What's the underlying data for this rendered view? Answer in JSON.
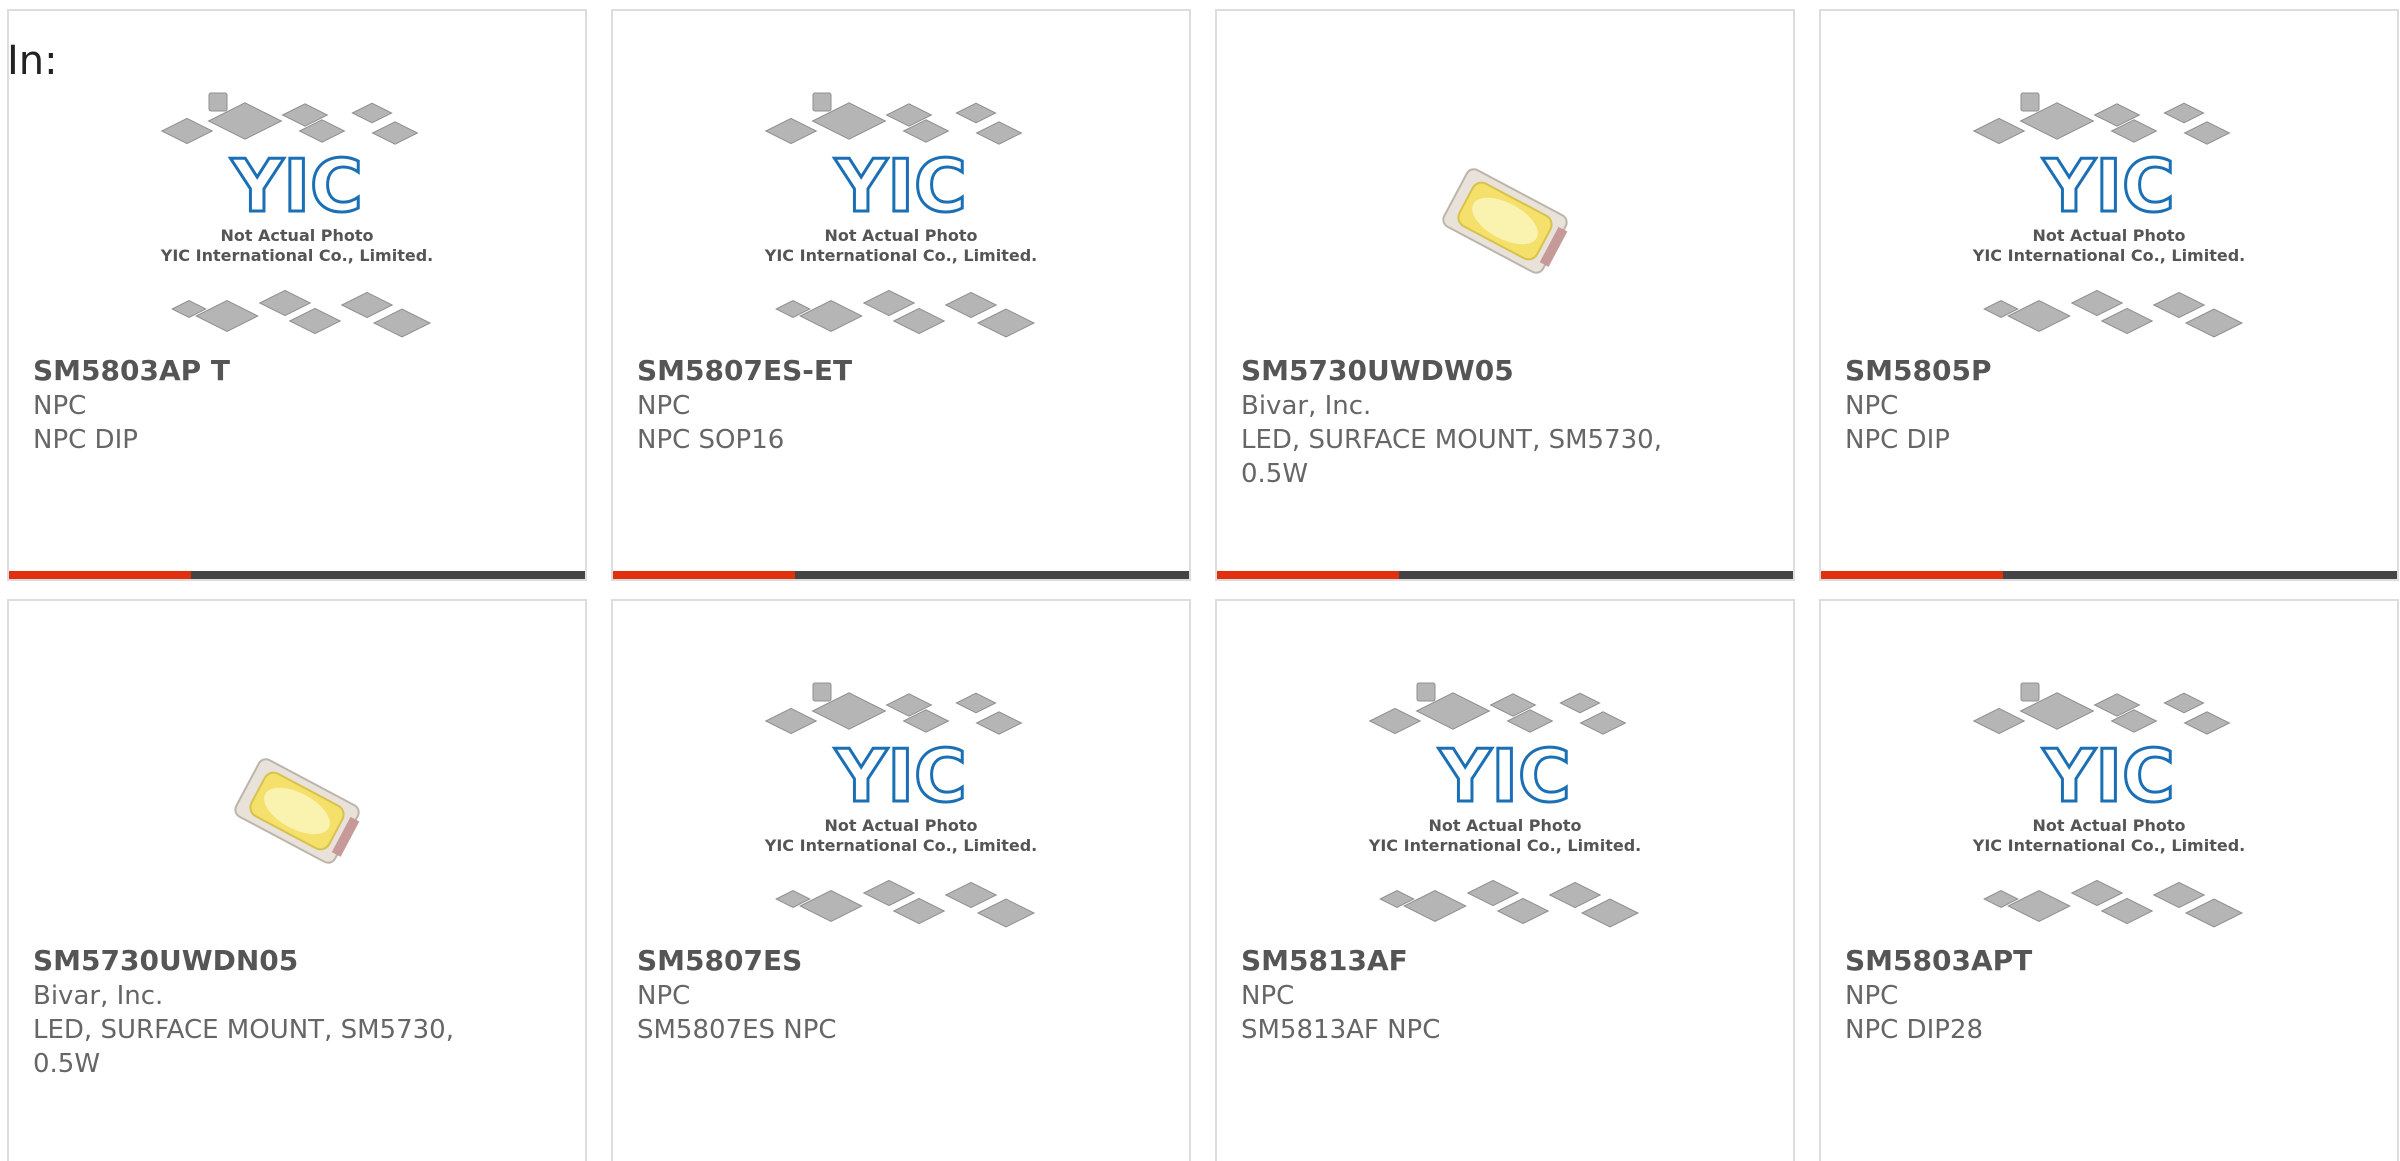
{
  "header": {
    "label": "In:"
  },
  "placeholder": {
    "logo_text": "YIC",
    "line1": "Not Actual Photo",
    "line2": "YIC International Co., Limited."
  },
  "colors": {
    "accent": "#e03010",
    "bar": "#444444",
    "border": "#dddddd",
    "text": "#666666",
    "logo_blue": "#1a6fb5"
  },
  "products": [
    {
      "part": "SM5803AP T",
      "maker": "NPC",
      "desc": "NPC DIP",
      "image": "placeholder-icon",
      "bar": true
    },
    {
      "part": "SM5807ES-ET",
      "maker": "NPC",
      "desc": "NPC SOP16",
      "image": "placeholder-icon",
      "bar": true
    },
    {
      "part": "SM5730UWDW05",
      "maker": "Bivar, Inc.",
      "desc": "LED, SURFACE MOUNT, SM5730, 0.5W",
      "image": "led-icon",
      "bar": true
    },
    {
      "part": "SM5805P",
      "maker": "NPC",
      "desc": "NPC DIP",
      "image": "placeholder-icon",
      "bar": true
    },
    {
      "part": "SM5730UWDN05",
      "maker": "Bivar, Inc.",
      "desc": "LED, SURFACE MOUNT, SM5730, 0.5W",
      "image": "led-icon",
      "bar": false
    },
    {
      "part": "SM5807ES",
      "maker": "NPC",
      "desc": "SM5807ES NPC",
      "image": "placeholder-icon",
      "bar": false
    },
    {
      "part": "SM5813AF",
      "maker": "NPC",
      "desc": "SM5813AF NPC",
      "image": "placeholder-icon",
      "bar": false
    },
    {
      "part": "SM5803APT",
      "maker": "NPC",
      "desc": "NPC DIP28",
      "image": "placeholder-icon",
      "bar": false
    }
  ]
}
